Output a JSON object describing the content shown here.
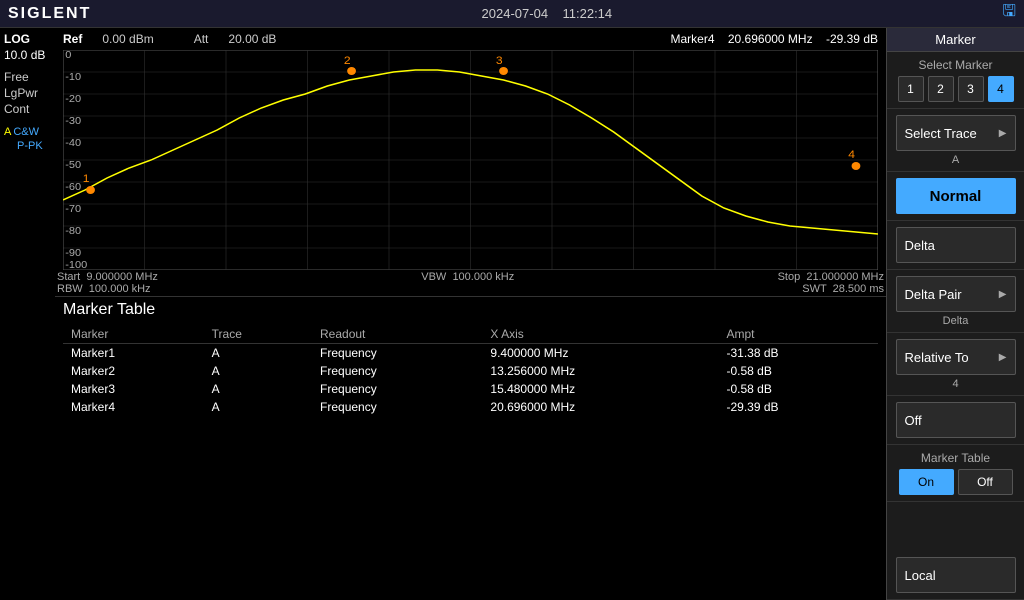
{
  "header": {
    "logo": "SIGLENT",
    "date": "2024-07-04",
    "time": "11:22:14",
    "title": "Marker"
  },
  "ref_bar": {
    "ref_label": "Ref",
    "ref_value": "0.00 dBm",
    "att_label": "Att",
    "att_value": "20.00 dB",
    "marker_name": "Marker4",
    "marker_freq": "20.696000 MHz",
    "marker_amp": "-29.39 dB"
  },
  "left_sidebar": {
    "scale": "LOG",
    "db": "10.0 dB",
    "modes": [
      "Free",
      "LgPwr",
      "Cont"
    ],
    "mode_a": "A",
    "cw": "C&W",
    "ppk": "P-PK"
  },
  "chart": {
    "y_labels": [
      "0",
      "-10",
      "-20",
      "-30",
      "-40",
      "-50",
      "-60",
      "-70",
      "-80",
      "-90",
      "-100"
    ],
    "x_start": "9.000000 MHz",
    "x_stop": "21.000000 MHz",
    "rbw_label": "RBW",
    "rbw_value": "100.000 kHz",
    "vbw_label": "VBW",
    "vbw_value": "100.000 kHz",
    "stop_label": "Stop",
    "stop_value": "21.000000 MHz",
    "swt_label": "SWT",
    "swt_value": "28.500 ms",
    "start_label": "Start"
  },
  "marker_table": {
    "title": "Marker Table",
    "headers": [
      "Marker",
      "Trace",
      "Readout",
      "X Axis",
      "Ampt"
    ],
    "rows": [
      {
        "marker": "Marker1",
        "trace": "A",
        "readout": "Frequency",
        "x_axis": "9.400000 MHz",
        "ampt": "-31.38 dB"
      },
      {
        "marker": "Marker2",
        "trace": "A",
        "readout": "Frequency",
        "x_axis": "13.256000 MHz",
        "ampt": "-0.58 dB"
      },
      {
        "marker": "Marker3",
        "trace": "A",
        "readout": "Frequency",
        "x_axis": "15.480000 MHz",
        "ampt": "-0.58 dB"
      },
      {
        "marker": "Marker4",
        "trace": "A",
        "readout": "Frequency",
        "x_axis": "20.696000 MHz",
        "ampt": "-29.39 dB"
      }
    ]
  },
  "right_panel": {
    "title": "Marker",
    "select_marker": {
      "label": "Select Marker",
      "buttons": [
        "1",
        "2",
        "3",
        "4"
      ],
      "active": "4"
    },
    "select_trace": {
      "label": "Select Trace",
      "value": "A"
    },
    "normal": {
      "label": "Normal"
    },
    "delta": {
      "label": "Delta"
    },
    "delta_pair": {
      "label": "Delta Pair",
      "sub": "Delta"
    },
    "relative_to": {
      "label": "Relative To",
      "value": "4"
    },
    "off": {
      "label": "Off"
    },
    "marker_table": {
      "label": "Marker Table",
      "on": "On",
      "off": "Off",
      "active": "On"
    },
    "local": {
      "label": "Local"
    }
  }
}
